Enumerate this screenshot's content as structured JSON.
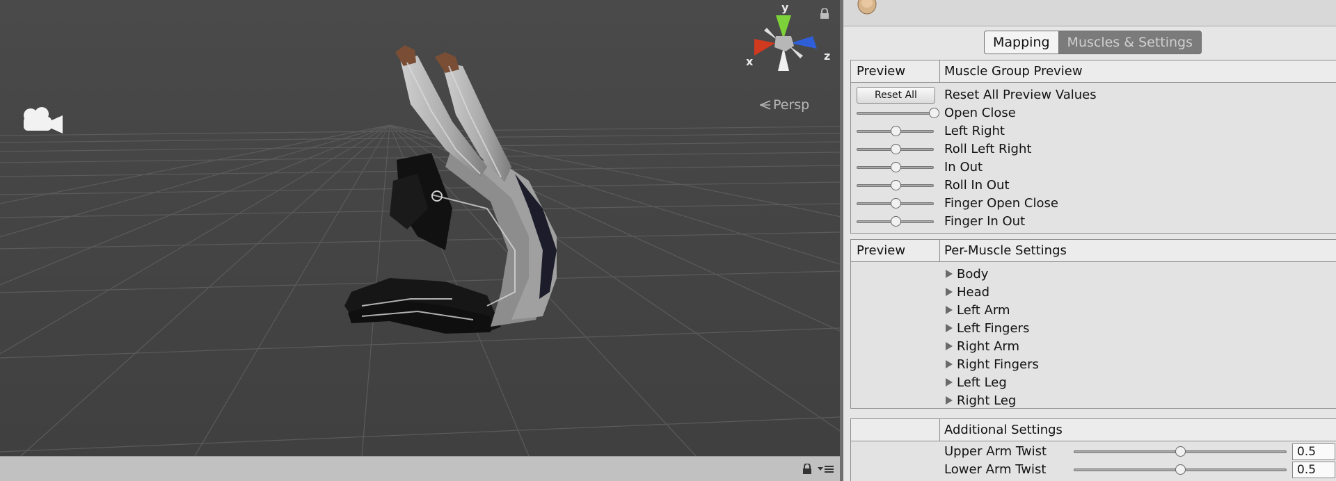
{
  "scene": {
    "camera_mode": "Persp",
    "gizmo": {
      "x_label": "x",
      "y_label": "y",
      "z_label": "z"
    },
    "icons": [
      "lock-icon",
      "camera-icon",
      "menu-icon"
    ],
    "colors": {
      "background": "#464646",
      "grid": "#5a5a5a",
      "x_axis": "#d23a20",
      "y_axis": "#7dd23a",
      "z_axis": "#2f5fd8"
    }
  },
  "inspector": {
    "tabs": [
      {
        "label": "Mapping",
        "active": true
      },
      {
        "label": "Muscles & Settings",
        "active": false
      }
    ],
    "muscle_group_preview": {
      "header_left": "Preview",
      "header_right": "Muscle Group Preview",
      "reset_button": "Reset All",
      "reset_label": "Reset All Preview Values",
      "sliders": [
        {
          "label": "Open Close",
          "value": 1.0
        },
        {
          "label": "Left Right",
          "value": 0.5
        },
        {
          "label": "Roll Left Right",
          "value": 0.5
        },
        {
          "label": "In Out",
          "value": 0.5
        },
        {
          "label": "Roll In Out",
          "value": 0.5
        },
        {
          "label": "Finger Open Close",
          "value": 0.5
        },
        {
          "label": "Finger In Out",
          "value": 0.5
        }
      ]
    },
    "per_muscle_settings": {
      "header_left": "Preview",
      "header_right": "Per-Muscle Settings",
      "groups": [
        "Body",
        "Head",
        "Left Arm",
        "Left Fingers",
        "Right Arm",
        "Right Fingers",
        "Left Leg",
        "Right Leg"
      ]
    },
    "additional_settings": {
      "header_left": "",
      "header_right": "Additional Settings",
      "fields": [
        {
          "label": "Upper Arm Twist",
          "value": "0.5",
          "slider": 0.5
        },
        {
          "label": "Lower Arm Twist",
          "value": "0.5",
          "slider": 0.5
        }
      ]
    }
  }
}
